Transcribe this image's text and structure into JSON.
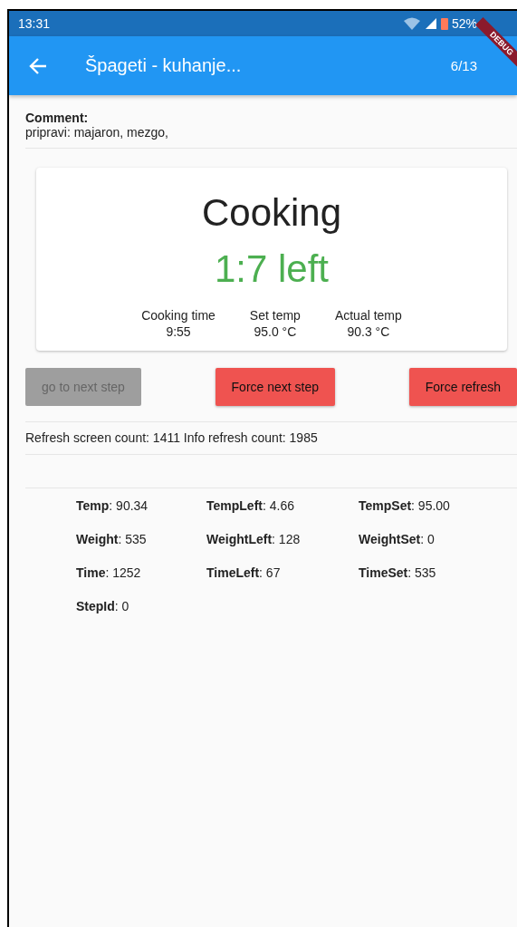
{
  "status_bar": {
    "time": "13:31",
    "battery": "52%"
  },
  "debug_banner": "DEBUG",
  "app_bar": {
    "title": "Špageti - kuhanje...",
    "step": "6/13"
  },
  "comment": {
    "label": "Comment:",
    "text": "pripravi: majaron, mezgo,"
  },
  "status_card": {
    "title": "Cooking",
    "remaining": "1:7 left",
    "stats": [
      {
        "label": "Cooking time",
        "value": "9:55"
      },
      {
        "label": "Set temp",
        "value": "95.0 °C"
      },
      {
        "label": "Actual temp",
        "value": "90.3 °C"
      }
    ]
  },
  "buttons": [
    {
      "label": "go to next step",
      "disabled": true
    },
    {
      "label": "Force next step",
      "disabled": false
    },
    {
      "label": "Force refresh",
      "disabled": false
    }
  ],
  "counts": "Refresh screen count: 1411 Info refresh count: 1985",
  "fields": [
    "**Temp**: 90.34",
    "**TempLeft**: 4.66",
    "**TempSet**: 95.00",
    "**Weight**: 535",
    "**WeightLeft**: 128",
    "**WeightSet**: 0",
    "**Time**: 1252",
    "**TimeLeft**: 67",
    "**TimeSet**: 535",
    "**StepId**: 0"
  ]
}
